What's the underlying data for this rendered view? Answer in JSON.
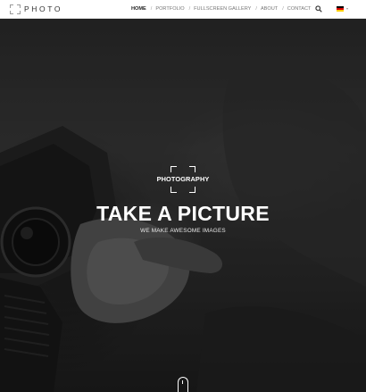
{
  "header": {
    "logo_text": "PHOTO",
    "nav": [
      {
        "label": "HOME",
        "active": true
      },
      {
        "label": "PORTFOLIO",
        "active": false
      },
      {
        "label": "FULLSCREEN GALLERY",
        "active": false
      },
      {
        "label": "ABOUT",
        "active": false
      },
      {
        "label": "CONTACT",
        "active": false
      }
    ],
    "nav_separator": "/",
    "search_icon": "search-icon",
    "language": {
      "icon": "german-flag-icon",
      "colors": [
        "#000000",
        "#dd0000",
        "#ffce00"
      ]
    }
  },
  "hero": {
    "badge_text": "PHOTOGRAPHY",
    "headline": "TAKE A PICTURE",
    "subline": "WE MAKE AWESOME IMAGES",
    "scroll_icon": "mouse-scroll-icon"
  },
  "colors": {
    "header_bg": "#ffffff",
    "active_nav": "#222222",
    "nav_text": "#777777",
    "hero_text": "#ffffff"
  }
}
